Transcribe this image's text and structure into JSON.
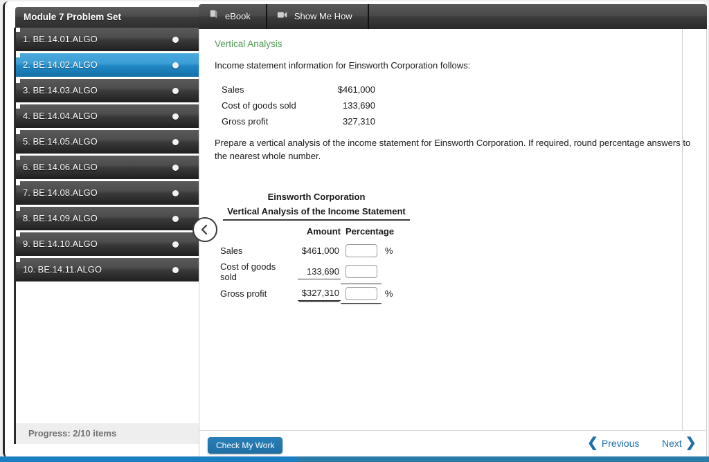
{
  "sidebar": {
    "header_title": "Module 7 Problem Set",
    "progress_label": "Progress:  2/10 items",
    "collapse_icon": "chevron-left-icon",
    "items": [
      {
        "label": "1.  BE.14.01.ALGO",
        "selected": false
      },
      {
        "label": "2.  BE.14.02.ALGO",
        "selected": true
      },
      {
        "label": "3.  BE.14.03.ALGO",
        "selected": false
      },
      {
        "label": "4.  BE.14.04.ALGO",
        "selected": false
      },
      {
        "label": "5.  BE.14.05.ALGO",
        "selected": false
      },
      {
        "label": "6.  BE.14.06.ALGO",
        "selected": false
      },
      {
        "label": "7.  BE.14.08.ALGO",
        "selected": false
      },
      {
        "label": "8.  BE.14.09.ALGO",
        "selected": false
      },
      {
        "label": "9.  BE.14.10.ALGO",
        "selected": false
      },
      {
        "label": "10.  BE.14.11.ALGO",
        "selected": false
      }
    ]
  },
  "tabs": [
    {
      "label": "eBook",
      "icon": "book-icon"
    },
    {
      "label": "Show Me How",
      "icon": "video-camera-icon"
    }
  ],
  "content": {
    "title": "Vertical Analysis",
    "intro": "Income statement information for Einsworth Corporation follows:",
    "facts": [
      {
        "label": "Sales",
        "value": "$461,000"
      },
      {
        "label": "Cost of goods sold",
        "value": "133,690"
      },
      {
        "label": "Gross profit",
        "value": "327,310"
      }
    ],
    "instruction": "Prepare a vertical analysis of the income statement for Einsworth Corporation. If required, round percentage answers to the nearest whole number."
  },
  "answer_table": {
    "company": "Einsworth Corporation",
    "statement_title": "Vertical Analysis of the Income Statement",
    "col_amount": "Amount",
    "col_percentage": "Percentage",
    "percent_symbol": "%",
    "rows": [
      {
        "label": "Sales",
        "amount": "$461,000",
        "input_value": "",
        "show_percent_symbol": true,
        "amount_rule": "none",
        "input_rule": "none"
      },
      {
        "label": "Cost of goods sold",
        "amount": "133,690",
        "input_value": "",
        "show_percent_symbol": false,
        "amount_rule": "single",
        "input_rule": "single"
      },
      {
        "label": "Gross profit",
        "amount": "$327,310",
        "input_value": "",
        "show_percent_symbol": true,
        "amount_rule": "double",
        "input_rule": "double"
      }
    ]
  },
  "footer": {
    "check_label": "Check My Work",
    "previous_label": "Previous",
    "next_label": "Next",
    "prev_icon": "chevron-left-icon",
    "next_icon": "chevron-right-icon"
  },
  "colors": {
    "accent_blue": "#1a7fc1",
    "selected_item": "#2f9bd6",
    "title_green": "#4f9a53",
    "button_blue": "#2980b9",
    "chrome_dark": "#3a3a3a"
  }
}
